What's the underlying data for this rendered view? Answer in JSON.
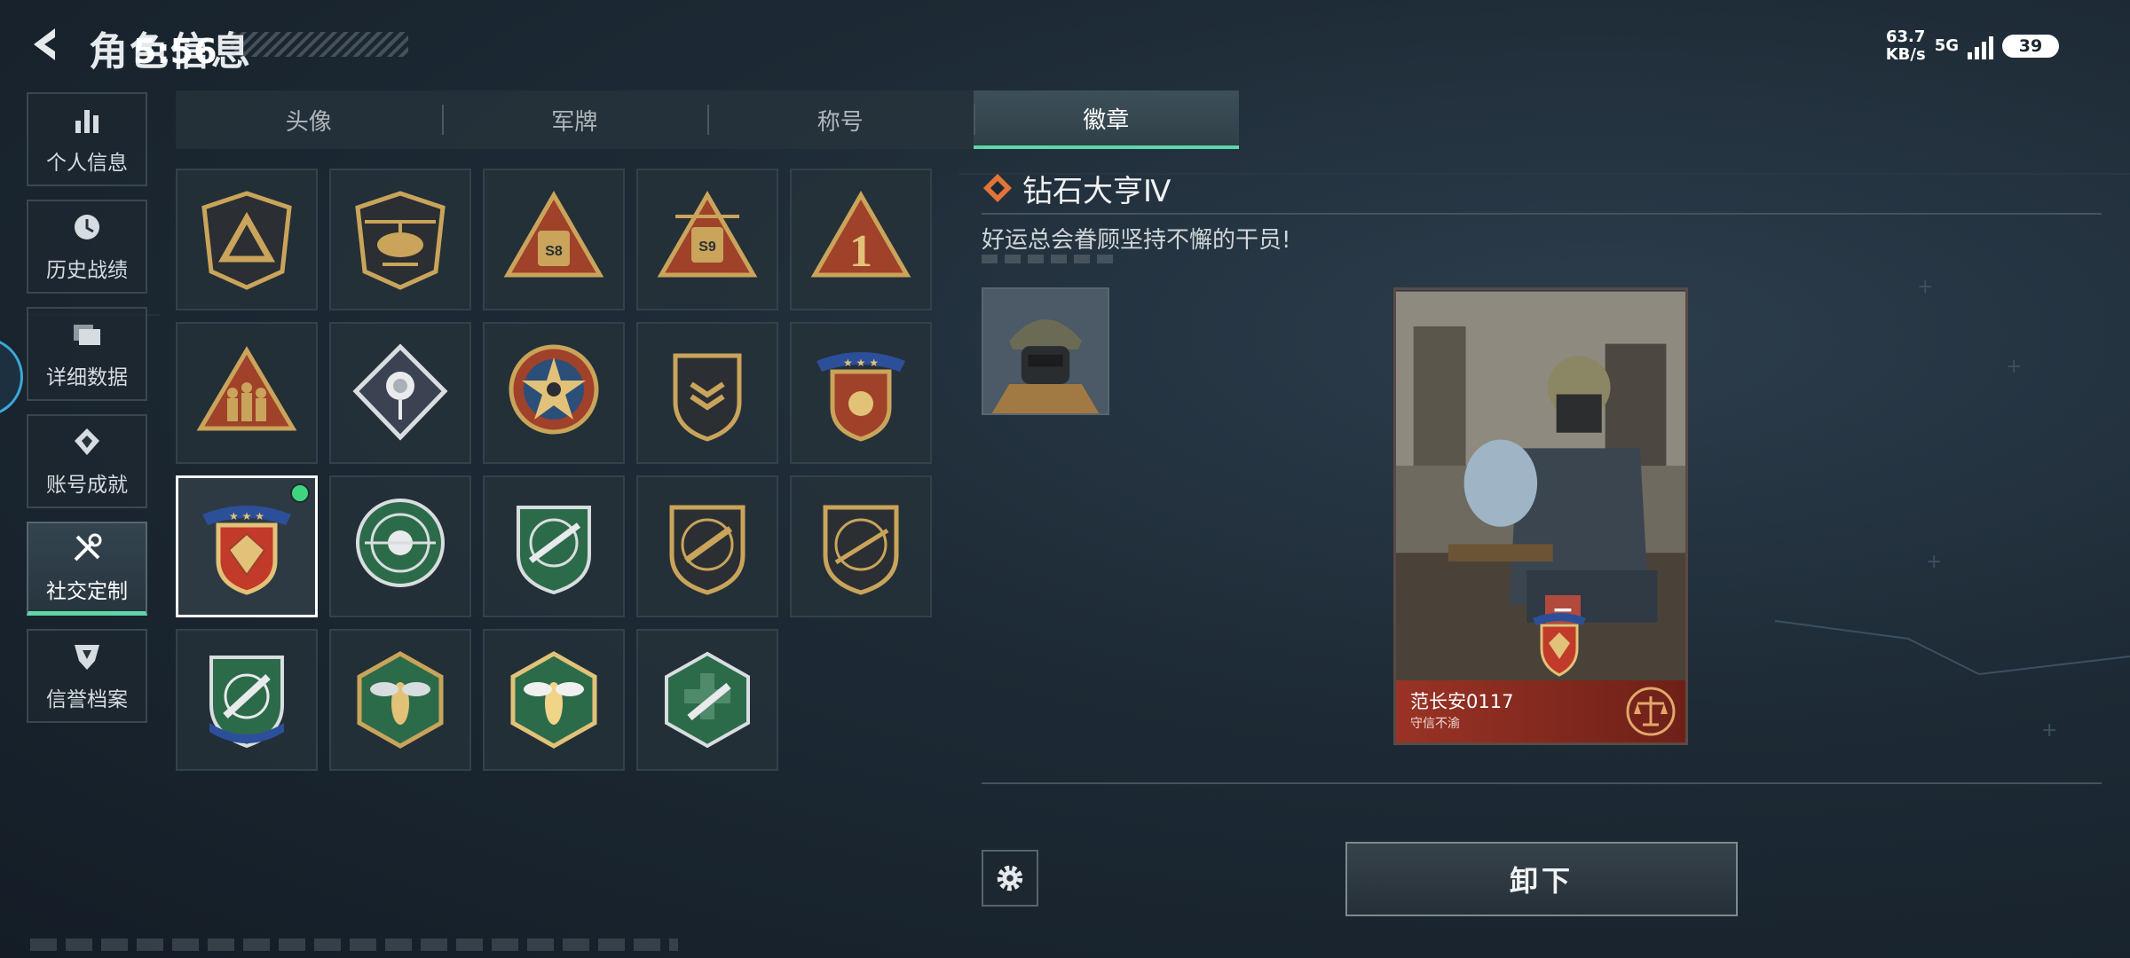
{
  "header": {
    "title": "角色信息",
    "clock": "5:56"
  },
  "status_bar": {
    "speed_value": "63.7",
    "speed_unit": "KB/s",
    "network": "5G",
    "battery": "39"
  },
  "sidebar": {
    "items": [
      {
        "label": "个人信息",
        "icon": "bar-chart-icon",
        "active": false
      },
      {
        "label": "历史战绩",
        "icon": "clock-icon",
        "active": false
      },
      {
        "label": "详细数据",
        "icon": "folder-icon",
        "active": false
      },
      {
        "label": "账号成就",
        "icon": "achievement-icon",
        "active": false
      },
      {
        "label": "社交定制",
        "icon": "wrench-screwdriver-icon",
        "active": true
      },
      {
        "label": "信誉档案",
        "icon": "reputation-icon",
        "active": false
      }
    ]
  },
  "tabs": [
    {
      "label": "头像",
      "active": false
    },
    {
      "label": "军牌",
      "active": false
    },
    {
      "label": "称号",
      "active": false
    },
    {
      "label": "徽章",
      "active": true
    }
  ],
  "badges": [
    {
      "icon": "triangle-shield-badge"
    },
    {
      "icon": "helicopter-badge"
    },
    {
      "icon": "s8-vehicle-badge",
      "text": "S8"
    },
    {
      "icon": "s9-vehicle-badge",
      "text": "S9"
    },
    {
      "icon": "number-one-badge",
      "text": "1"
    },
    {
      "icon": "soldiers-triangle-badge"
    },
    {
      "icon": "rose-diamond-badge"
    },
    {
      "icon": "star-compass-badge"
    },
    {
      "icon": "chevron-shield-badge"
    },
    {
      "icon": "star-banner-shield-badge"
    },
    {
      "icon": "diamond-banner-shield-badge",
      "selected": true,
      "equipped": true
    },
    {
      "icon": "sniper-skull-badge"
    },
    {
      "icon": "rifle-crosshair-green-badge"
    },
    {
      "icon": "rifle-shield-gold-badge"
    },
    {
      "icon": "sniper-shield-gold-badge"
    },
    {
      "icon": "knife-shield-badge"
    },
    {
      "icon": "wasp-hexagon-badge"
    },
    {
      "icon": "wasp-hexagon-gold-badge"
    },
    {
      "icon": "medic-gun-hexagon-badge"
    }
  ],
  "detail": {
    "name": "钻石大亨Ⅳ",
    "description": "好运总会眷顾坚持不懈的干员!",
    "card_name": "范长安0117",
    "card_subtitle": "守信不渝",
    "card_minus": "−",
    "unequip_label": "卸下"
  },
  "colors": {
    "accent": "#5fd6a8",
    "equipped_dot": "#3fd57f",
    "card_red": "#9a3325",
    "badge_gold": "#c9a45a",
    "badge_green": "#2c6b4a"
  }
}
